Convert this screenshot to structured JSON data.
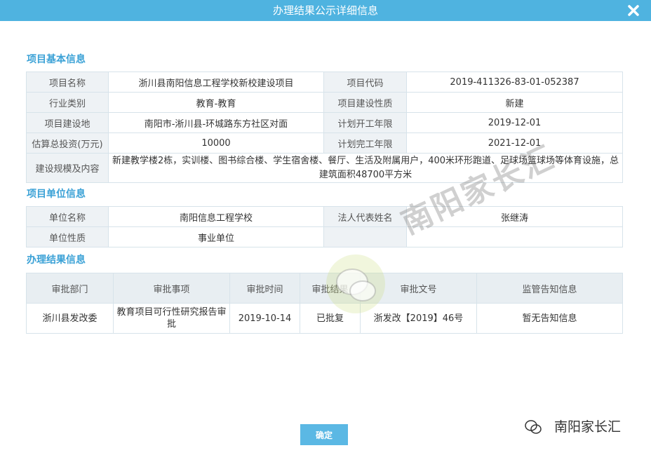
{
  "window": {
    "title": "办理结果公示详细信息"
  },
  "basic": {
    "section_title": "项目基本信息",
    "rows": [
      [
        "项目名称",
        "浙川县南阳信息工程学校新校建设项目",
        "项目代码",
        "2019-411326-83-01-052387"
      ],
      [
        "行业类别",
        "教育-教育",
        "项目建设性质",
        "新建"
      ],
      [
        "项目建设地",
        "南阳市-淅川县-环城路东方社区对面",
        "计划开工年限",
        "2019-12-01"
      ],
      [
        "估算总投资(万元)",
        "10000",
        "计划完工年限",
        "2021-12-01"
      ]
    ],
    "scale_label": "建设规模及内容",
    "scale_value": "新建教学楼2栋，实训楼、图书综合楼、学生宿舍楼、餐厅、生活及附属用户，400米环形跑道、足球场篮球场等体育设施，总建筑面积48700平方米"
  },
  "unit": {
    "section_title": "项目单位信息",
    "rows": [
      [
        "单位名称",
        "南阳信息工程学校",
        "法人代表姓名",
        "张继涛"
      ],
      [
        "单位性质",
        "事业单位",
        "",
        ""
      ]
    ]
  },
  "result": {
    "section_title": "办理结果信息",
    "headers": [
      "审批部门",
      "审批事项",
      "审批时间",
      "审批结果",
      "审批文号",
      "监管告知信息"
    ],
    "rows": [
      [
        "浙川县发改委",
        "教育项目可行性研究报告审批",
        "2019-10-14",
        "已批复",
        "浙发改【2019】46号",
        "暂无告知信息"
      ]
    ]
  },
  "footer": {
    "ok_label": "确定"
  },
  "watermark": {
    "text": "南阳家长汇"
  },
  "colors": {
    "accent": "#4fb3e0",
    "section": "#3aa1d6",
    "label_bg": "#eef2f5"
  }
}
